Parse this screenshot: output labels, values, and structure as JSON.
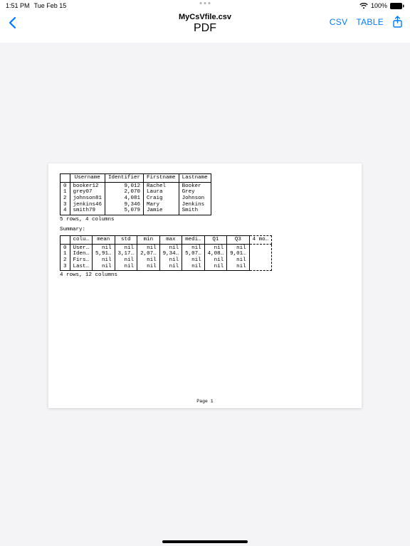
{
  "status": {
    "time": "1:51 PM",
    "date": "Tue Feb 15",
    "battery_pct": "100%"
  },
  "nav": {
    "filename": "MyCsVfile.csv",
    "mode": "PDF",
    "csv_label": "CSV",
    "table_label": "TABLE"
  },
  "table1": {
    "headers": [
      "",
      "Username",
      "Identifier",
      "Firstname",
      "Lastname"
    ],
    "rows": [
      [
        "0",
        "booker12",
        "9,012",
        "Rachel",
        "Booker"
      ],
      [
        "1",
        "grey07",
        "2,070",
        "Laura",
        "Grey"
      ],
      [
        "2",
        "johnson81",
        "4,081",
        "Craig",
        "Johnson"
      ],
      [
        "3",
        "jenkins46",
        "9,346",
        "Mary",
        "Jenkins"
      ],
      [
        "4",
        "smith79",
        "5,079",
        "Jamie",
        "Smith"
      ]
    ],
    "meta": "5 rows, 4 columns"
  },
  "summary_label": "Summary:",
  "table2": {
    "headers": [
      "",
      "colu…",
      "mean",
      "std",
      "min",
      "max",
      "medi…",
      "Q1",
      "Q3",
      "4 mo…"
    ],
    "rows": [
      [
        "0",
        "User…",
        "nil",
        "nil",
        "nil",
        "nil",
        "nil",
        "nil",
        "nil",
        ""
      ],
      [
        "1",
        "Iden…",
        "5,91…",
        "3,17…",
        "2,07…",
        "9,34…",
        "5,07…",
        "4,08…",
        "9,01…",
        ""
      ],
      [
        "2",
        "Firs…",
        "nil",
        "nil",
        "nil",
        "nil",
        "nil",
        "nil",
        "nil",
        ""
      ],
      [
        "3",
        "Last…",
        "nil",
        "nil",
        "nil",
        "nil",
        "nil",
        "nil",
        "nil",
        ""
      ]
    ],
    "meta": "4 rows, 12 columns"
  },
  "page_label": "Page 1"
}
